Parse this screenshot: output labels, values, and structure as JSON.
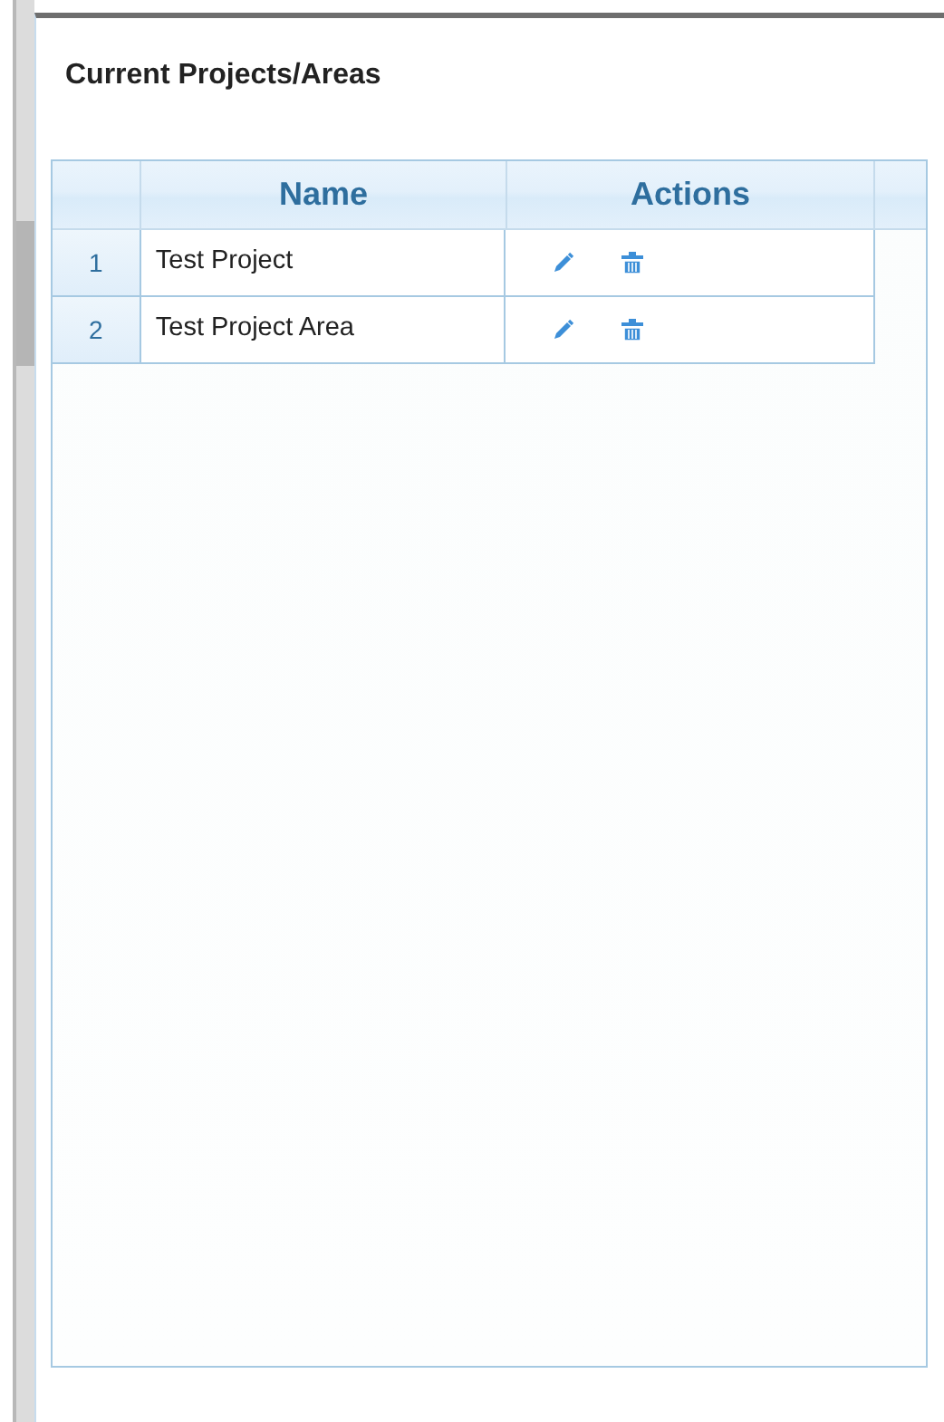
{
  "panel": {
    "title": "Current Projects/Areas"
  },
  "table": {
    "columns": [
      "Name",
      "Actions"
    ],
    "rows": [
      {
        "number": "1",
        "name": "Test Project"
      },
      {
        "number": "2",
        "name": "Test Project Area"
      }
    ]
  }
}
